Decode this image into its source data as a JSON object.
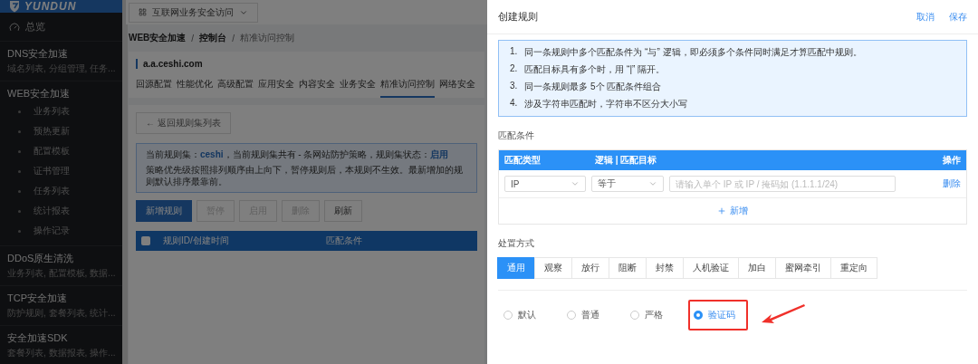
{
  "logo": {
    "text": "YUNDUN"
  },
  "sidebar": {
    "items": [
      {
        "kind": "link",
        "label": "总览"
      },
      {
        "kind": "group",
        "label": "DNS安全加速",
        "summary": "域名列表, 分组管理, 任务..."
      },
      {
        "kind": "section",
        "label": "WEB安全加速",
        "children": [
          {
            "label": "业务列表"
          },
          {
            "label": "预热更新"
          },
          {
            "label": "配置模板"
          },
          {
            "label": "证书管理"
          },
          {
            "label": "任务列表"
          },
          {
            "label": "统计报表"
          },
          {
            "label": "操作记录"
          }
        ]
      },
      {
        "kind": "group",
        "label": "DDoS原生清洗",
        "summary": "业务列表, 配置模板, 数据..."
      },
      {
        "kind": "group",
        "label": "TCP安全加速",
        "summary": "防护规则, 套餐列表, 统计..."
      },
      {
        "kind": "group",
        "label": "安全加速SDK",
        "summary": "套餐列表, 数据报表, 操作..."
      }
    ]
  },
  "topbar": {
    "product_menu": "互联网业务安全访问"
  },
  "breadcrumb": [
    {
      "label": "WEB安全加速",
      "separator": "/"
    },
    {
      "label": "控制台",
      "separator": "/"
    },
    {
      "label": "精准访问控制"
    }
  ],
  "domain": "a.a.ceshi.com",
  "domain_tabs": [
    {
      "label": "回源配置",
      "selected": false
    },
    {
      "label": "性能优化",
      "selected": false
    },
    {
      "label": "高级配置",
      "selected": false
    },
    {
      "label": "应用安全",
      "selected": false
    },
    {
      "label": "内容安全",
      "selected": false
    },
    {
      "label": "业务安全",
      "selected": false
    },
    {
      "label": "精准访问控制",
      "selected": true
    },
    {
      "label": "网络安全",
      "selected": false
    }
  ],
  "back_button": "← 返回规则集列表",
  "notice": [
    [
      {
        "text": "当前规则集：",
        "highlight": false
      },
      {
        "text": "ceshi",
        "highlight": true
      },
      {
        "text": "，当前规则集共有 - 条网站防护策略，规则集状态：",
        "highlight": false
      },
      {
        "text": "启用",
        "highlight": true
      }
    ],
    [
      {
        "text": "策略优先级按照排列顺序由上向下，暂停规则后，本规则不生效。最新增加的规则默认排序最靠前。",
        "highlight": false
      }
    ]
  ],
  "rule_buttons": [
    {
      "label": "新增规则",
      "kind": "primary",
      "disabled": false
    },
    {
      "label": "暂停",
      "kind": "default",
      "disabled": true
    },
    {
      "label": "启用",
      "kind": "default",
      "disabled": true
    },
    {
      "label": "删除",
      "kind": "default",
      "disabled": true
    },
    {
      "label": "刷新",
      "kind": "default",
      "disabled": false
    }
  ],
  "rules_table": {
    "select_all_checked": false,
    "columns": [
      "规则ID/创建时间",
      "匹配条件"
    ]
  },
  "drawer": {
    "title": "创建规则",
    "actions": [
      "取消",
      "保存"
    ],
    "tips": [
      {
        "number": "1.",
        "text": "同一条规则中多个匹配条件为 “与” 逻辑，即必须多个条件同时满足才算匹配中规则。"
      },
      {
        "number": "2.",
        "text": "匹配目标具有多个时，用 “|” 隔开。"
      },
      {
        "number": "3.",
        "text": "同一条规则最多 5个 匹配条件组合"
      },
      {
        "number": "4.",
        "text": "涉及字符串匹配时，字符串不区分大小写"
      }
    ],
    "match_title": "匹配条件",
    "match_columns": [
      "匹配类型",
      "逻辑 | 匹配目标",
      "操作"
    ],
    "match_rows": [
      {
        "type": "IP",
        "operator": "等于",
        "target_placeholder": "请输入单个 IP 或 IP / 掩码如 (1.1.1.1/24)",
        "action": "删除"
      }
    ],
    "add_label": "新增",
    "action_title": "处置方式",
    "action_tabs": [
      {
        "label": "通用",
        "selected": true
      },
      {
        "label": "观察",
        "selected": false
      },
      {
        "label": "放行",
        "selected": false
      },
      {
        "label": "阻断",
        "selected": false
      },
      {
        "label": "封禁",
        "selected": false
      },
      {
        "label": "人机验证",
        "selected": false
      },
      {
        "label": "加白",
        "selected": false
      },
      {
        "label": "蜜网牵引",
        "selected": false
      },
      {
        "label": "重定向",
        "selected": false
      }
    ],
    "levels": [
      {
        "label": "默认",
        "selected": false,
        "highlighted": false
      },
      {
        "label": "普通",
        "selected": false,
        "highlighted": false
      },
      {
        "label": "严格",
        "selected": false,
        "highlighted": false
      },
      {
        "label": "验证码",
        "selected": true,
        "highlighted": true
      }
    ]
  }
}
